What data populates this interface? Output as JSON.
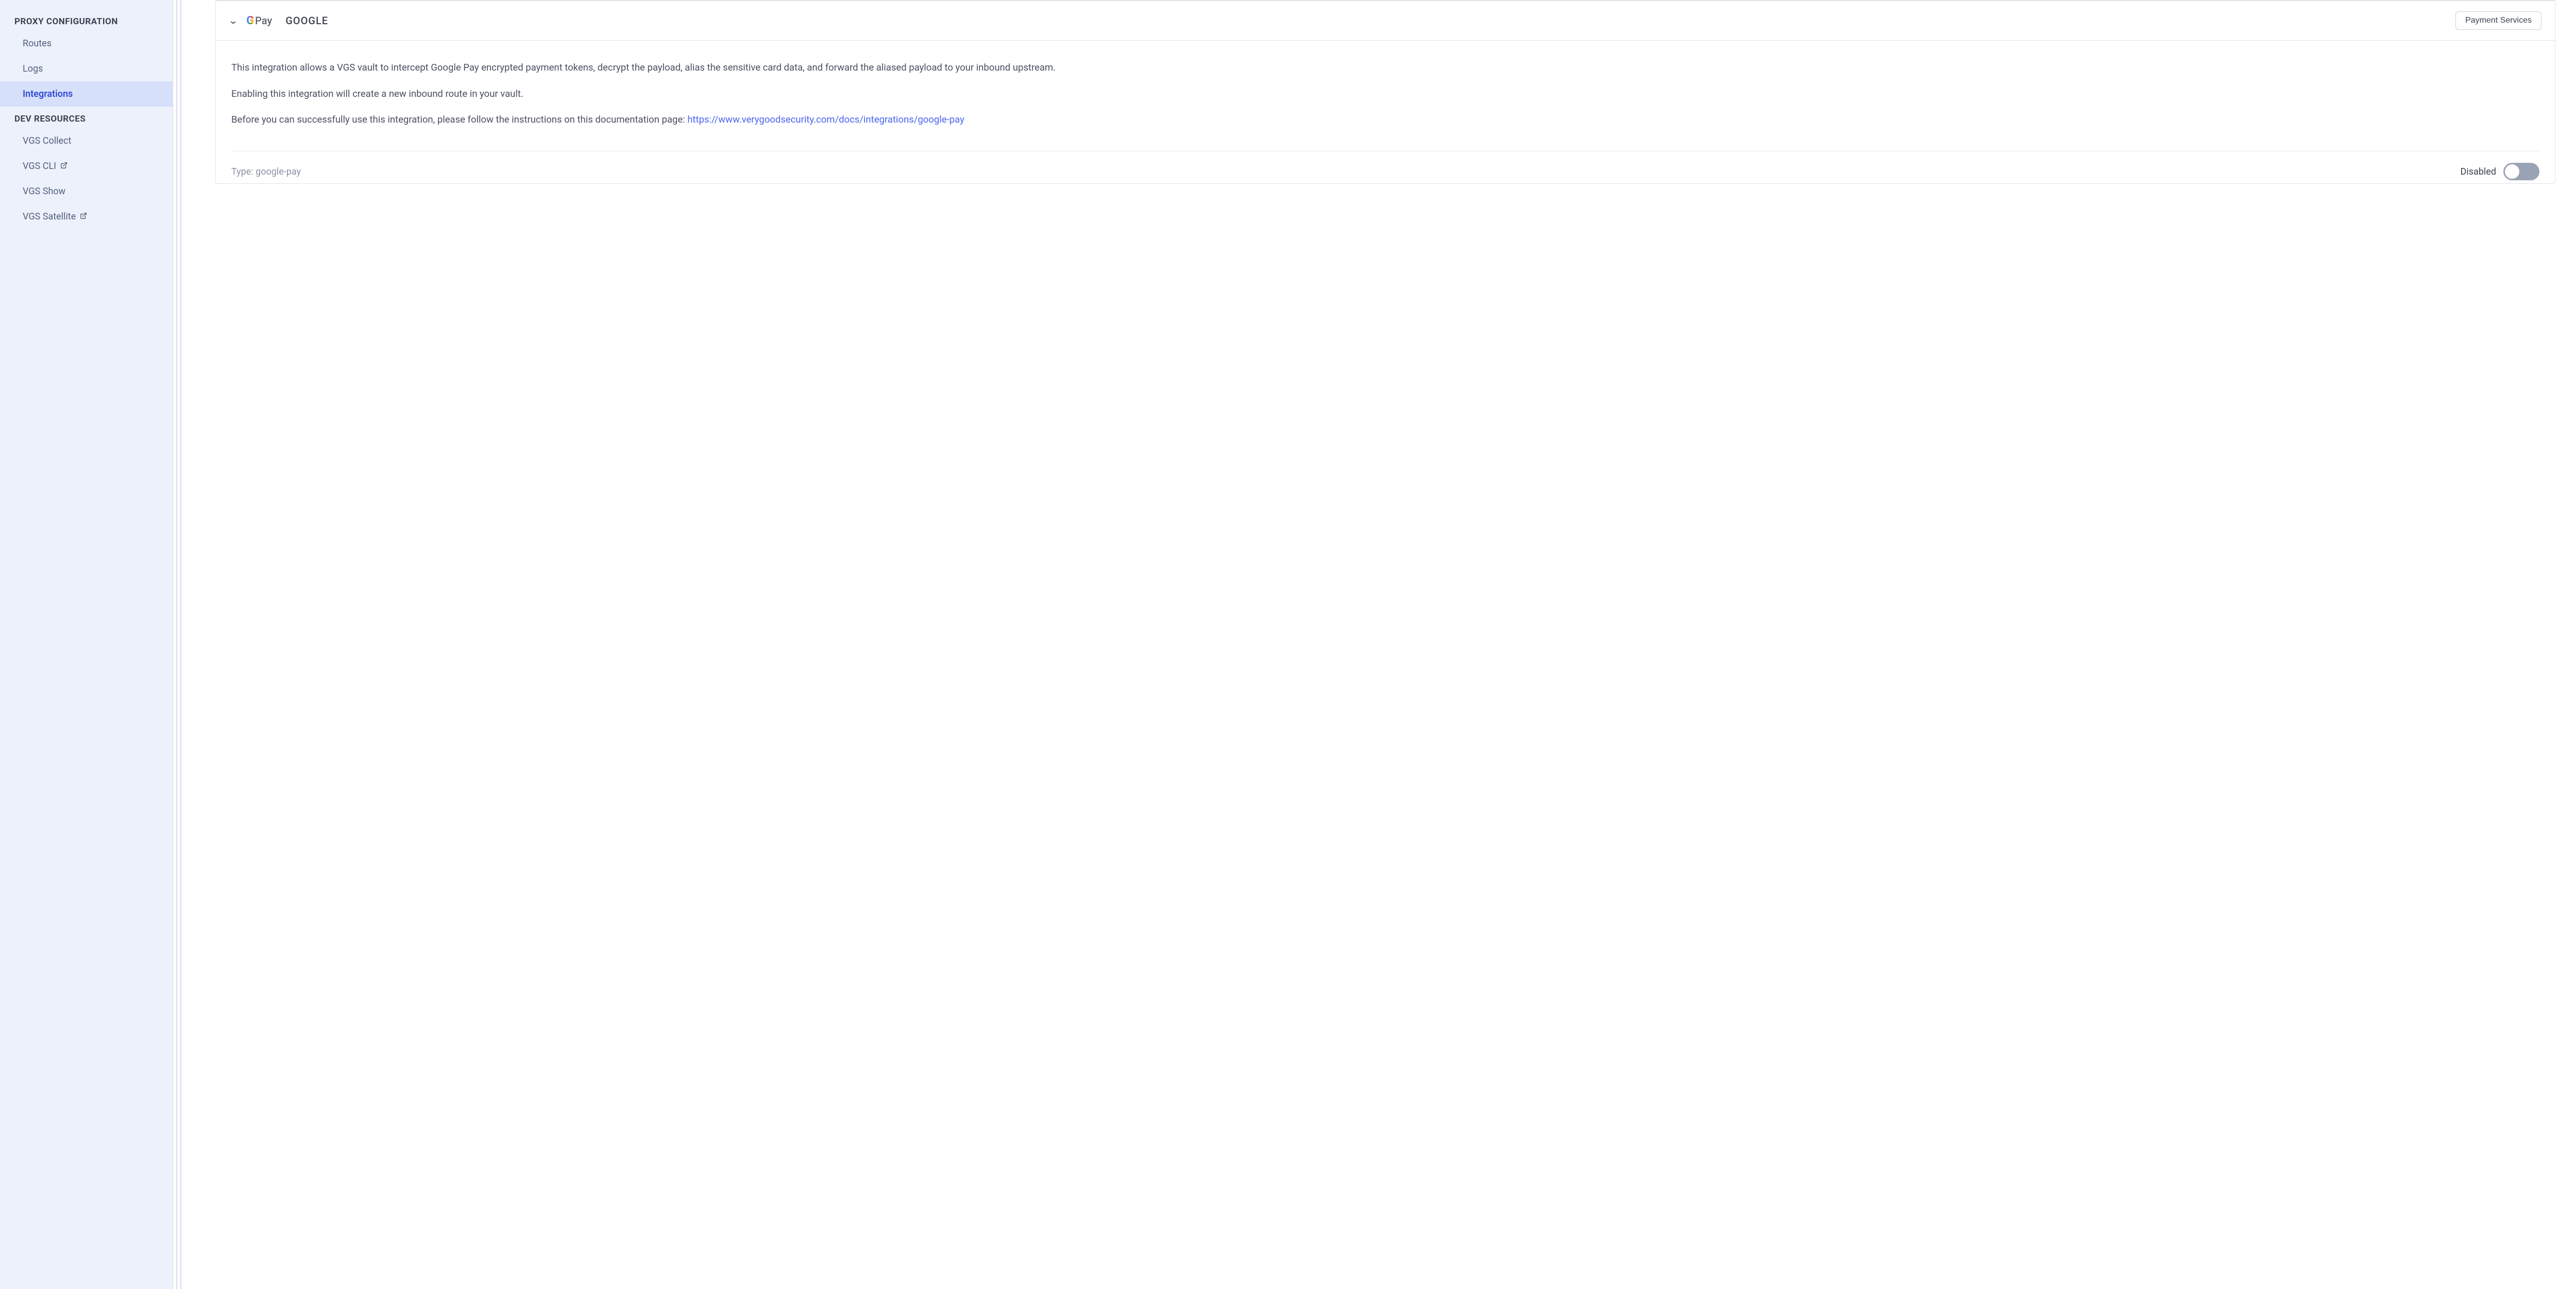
{
  "sidebar": {
    "sections": [
      {
        "header": "PROXY CONFIGURATION",
        "items": [
          {
            "label": "Routes",
            "active": false,
            "external": false
          },
          {
            "label": "Logs",
            "active": false,
            "external": false
          },
          {
            "label": "Integrations",
            "active": true,
            "external": false
          }
        ]
      },
      {
        "header": "DEV RESOURCES",
        "items": [
          {
            "label": "VGS Collect",
            "active": false,
            "external": false
          },
          {
            "label": "VGS CLI",
            "active": false,
            "external": true
          },
          {
            "label": "VGS Show",
            "active": false,
            "external": false
          },
          {
            "label": "VGS Satellite",
            "active": false,
            "external": true
          }
        ]
      }
    ]
  },
  "integration": {
    "logo_prefix": "G",
    "logo_suffix": "Pay",
    "name": "GOOGLE",
    "category_button": "Payment Services",
    "paragraphs": [
      "This integration allows a VGS vault to intercept Google Pay encrypted payment tokens, decrypt the payload, alias the sensitive card data, and forward the aliased payload to your inbound upstream.",
      "Enabling this integration will create a new inbound route in your vault."
    ],
    "doc_intro": "Before you can successfully use this integration, please follow the instructions on this documentation page: ",
    "doc_link": "https://www.verygoodsecurity.com/docs/integrations/google-pay",
    "type_label": "Type: ",
    "type_value": "google-pay",
    "toggle_label": "Disabled",
    "toggle_on": false
  }
}
